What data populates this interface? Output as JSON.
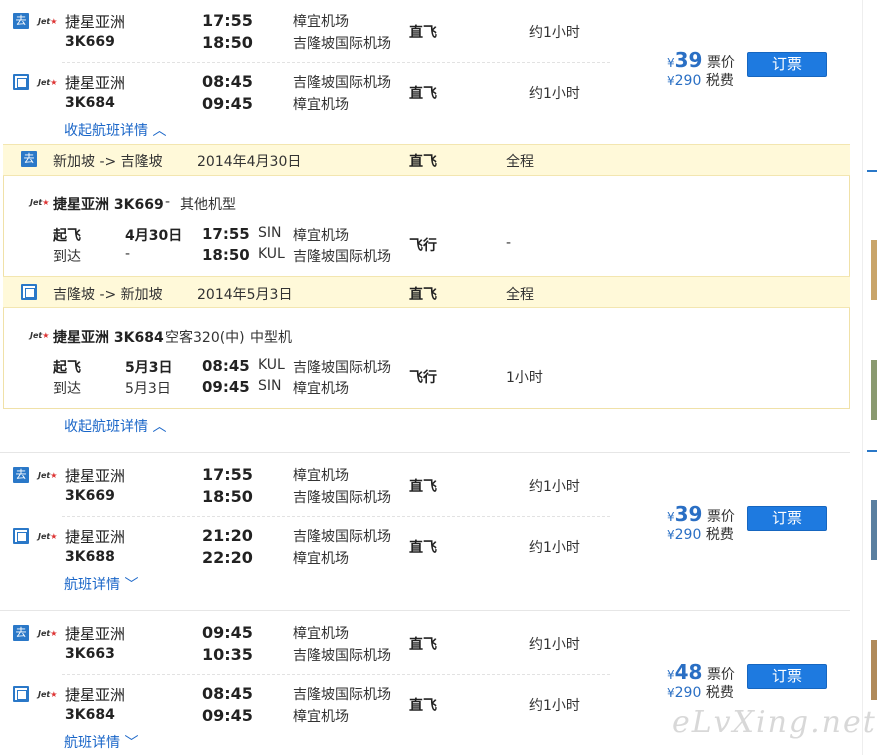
{
  "results": [
    {
      "outbound": {
        "dir": "去",
        "airline": "捷星亚洲",
        "flight": "3K669",
        "dep": "17:55",
        "arr": "18:50",
        "from": "樟宜机场",
        "to": "吉隆坡国际机场",
        "type": "直飞",
        "duration": "约1小时"
      },
      "inbound": {
        "dir": "回",
        "airline": "捷星亚洲",
        "flight": "3K684",
        "dep": "08:45",
        "arr": "09:45",
        "from": "吉隆坡国际机场",
        "to": "樟宜机场",
        "type": "直飞",
        "duration": "约1小时"
      },
      "price": "39",
      "tax": "290",
      "toggle": "收起航班详情"
    },
    {
      "outbound": {
        "dir": "去",
        "airline": "捷星亚洲",
        "flight": "3K669",
        "dep": "17:55",
        "arr": "18:50",
        "from": "樟宜机场",
        "to": "吉隆坡国际机场",
        "type": "直飞",
        "duration": "约1小时"
      },
      "inbound": {
        "dir": "回",
        "airline": "捷星亚洲",
        "flight": "3K688",
        "dep": "21:20",
        "arr": "22:20",
        "from": "吉隆坡国际机场",
        "to": "樟宜机场",
        "type": "直飞",
        "duration": "约1小时"
      },
      "price": "39",
      "tax": "290",
      "toggle": "航班详情"
    },
    {
      "outbound": {
        "dir": "去",
        "airline": "捷星亚洲",
        "flight": "3K663",
        "dep": "09:45",
        "arr": "10:35",
        "from": "樟宜机场",
        "to": "吉隆坡国际机场",
        "type": "直飞",
        "duration": "约1小时"
      },
      "inbound": {
        "dir": "回",
        "airline": "捷星亚洲",
        "flight": "3K684",
        "dep": "08:45",
        "arr": "09:45",
        "from": "吉隆坡国际机场",
        "to": "樟宜机场",
        "type": "直飞",
        "duration": "约1小时"
      },
      "price": "48",
      "tax": "290",
      "toggle": "航班详情"
    }
  ],
  "labels": {
    "yen": "¥",
    "ticket": "票价",
    "tax": "税费",
    "book": "订票",
    "jet": "Jet"
  },
  "detail": {
    "outbound_band": {
      "dir": "去",
      "route": "新加坡 -> 吉隆坡",
      "date": "2014年4月30日",
      "type": "直飞",
      "scope": "全程"
    },
    "outbound_leg": {
      "airline_flight": "捷星亚洲 3K669",
      "sep": "-",
      "aircraft": "其他机型",
      "dep_label": "起飞",
      "arr_label": "到达",
      "dep_date": "4月30日",
      "arr_date": "-",
      "dep_time": "17:55",
      "arr_time": "18:50",
      "dep_code": "SIN",
      "arr_code": "KUL",
      "dep_apt": "樟宜机场",
      "arr_apt": "吉隆坡国际机场",
      "fly": "飞行",
      "fly_dur": "-"
    },
    "inbound_band": {
      "dir": "回",
      "route": "吉隆坡 -> 新加坡",
      "date": "2014年5月3日",
      "type": "直飞",
      "scope": "全程"
    },
    "inbound_leg": {
      "airline_flight": "捷星亚洲 3K684",
      "aircraft": "空客320(中)",
      "size": "中型机",
      "dep_label": "起飞",
      "arr_label": "到达",
      "dep_date": "5月3日",
      "arr_date": "5月3日",
      "dep_time": "08:45",
      "arr_time": "09:45",
      "dep_code": "KUL",
      "arr_code": "SIN",
      "dep_apt": "吉隆坡国际机场",
      "arr_apt": "樟宜机场",
      "fly": "飞行",
      "fly_dur": "1小时"
    },
    "collapse": "收起航班详情"
  },
  "watermark": "eLvXing.net",
  "colors": {
    "accent": "#1e7ae0",
    "price": "#2a6fc4",
    "band": "#fff9d9"
  }
}
